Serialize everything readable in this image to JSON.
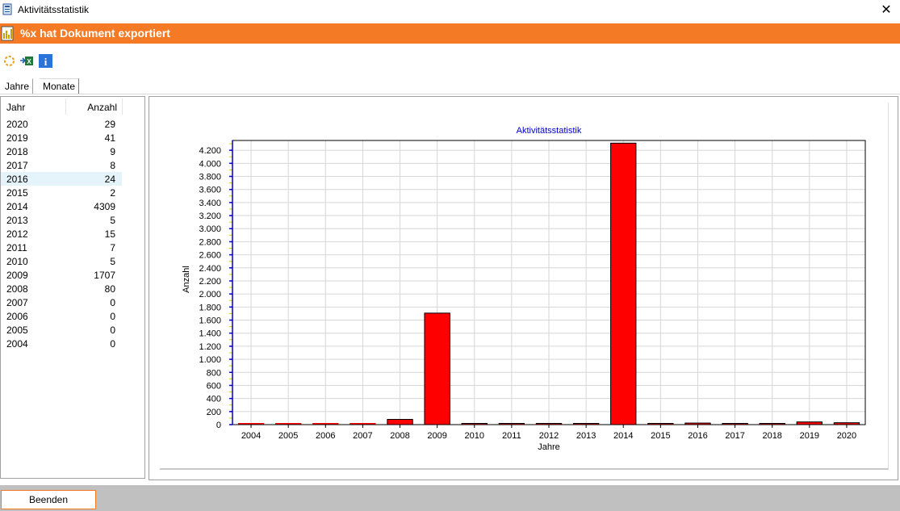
{
  "window": {
    "title": "Aktivitätsstatistik",
    "close_glyph": "✕",
    "icon": "app-icon"
  },
  "header": {
    "title": "%x hat Dokument exportiert",
    "icon": "document-chart-icon",
    "background": "#f47a25"
  },
  "toolbar": {
    "items": [
      {
        "icon": "refresh-icon"
      },
      {
        "icon": "excel-export-icon"
      },
      {
        "icon": "info-icon"
      }
    ]
  },
  "tabs": [
    {
      "label": "Jahre",
      "active": true
    },
    {
      "label": "Monate",
      "active": false
    }
  ],
  "list": {
    "columns": [
      "Jahr",
      "Anzahl"
    ],
    "selected_year": "2016",
    "rows": [
      [
        "2020",
        "29"
      ],
      [
        "2019",
        "41"
      ],
      [
        "2018",
        "9"
      ],
      [
        "2017",
        "8"
      ],
      [
        "2016",
        "24"
      ],
      [
        "2015",
        "2"
      ],
      [
        "2014",
        "4309"
      ],
      [
        "2013",
        "5"
      ],
      [
        "2012",
        "15"
      ],
      [
        "2011",
        "7"
      ],
      [
        "2010",
        "5"
      ],
      [
        "2009",
        "1707"
      ],
      [
        "2008",
        "80"
      ],
      [
        "2007",
        "0"
      ],
      [
        "2006",
        "0"
      ],
      [
        "2005",
        "0"
      ],
      [
        "2004",
        "0"
      ]
    ]
  },
  "chart_data": {
    "type": "bar",
    "title": "Aktivitätsstatistik",
    "xlabel": "Jahre",
    "ylabel": "Anzahl",
    "categories": [
      "2004",
      "2005",
      "2006",
      "2007",
      "2008",
      "2009",
      "2010",
      "2011",
      "2012",
      "2013",
      "2014",
      "2015",
      "2016",
      "2017",
      "2018",
      "2019",
      "2020"
    ],
    "values": [
      0,
      0,
      0,
      0,
      80,
      1707,
      5,
      7,
      15,
      5,
      4309,
      2,
      24,
      8,
      9,
      41,
      29
    ],
    "ylim": [
      0,
      4350
    ],
    "yticks": [
      0,
      200,
      400,
      600,
      800,
      1000,
      1200,
      1400,
      1600,
      1800,
      2000,
      2200,
      2400,
      2600,
      2800,
      3000,
      3200,
      3400,
      3600,
      3800,
      4000,
      4200
    ],
    "ytick_labels": [
      "0",
      "200",
      "400",
      "600",
      "800",
      "1.000",
      "1.200",
      "1.400",
      "1.600",
      "1.800",
      "2.000",
      "2.200",
      "2.400",
      "2.600",
      "2.800",
      "3.000",
      "3.200",
      "3.400",
      "3.600",
      "3.800",
      "4.000",
      "4.200"
    ],
    "grid": true,
    "legend": "none",
    "bar_color": "#ff0000",
    "title_color": "#0000cc"
  },
  "footer": {
    "button_label": "Beenden"
  }
}
